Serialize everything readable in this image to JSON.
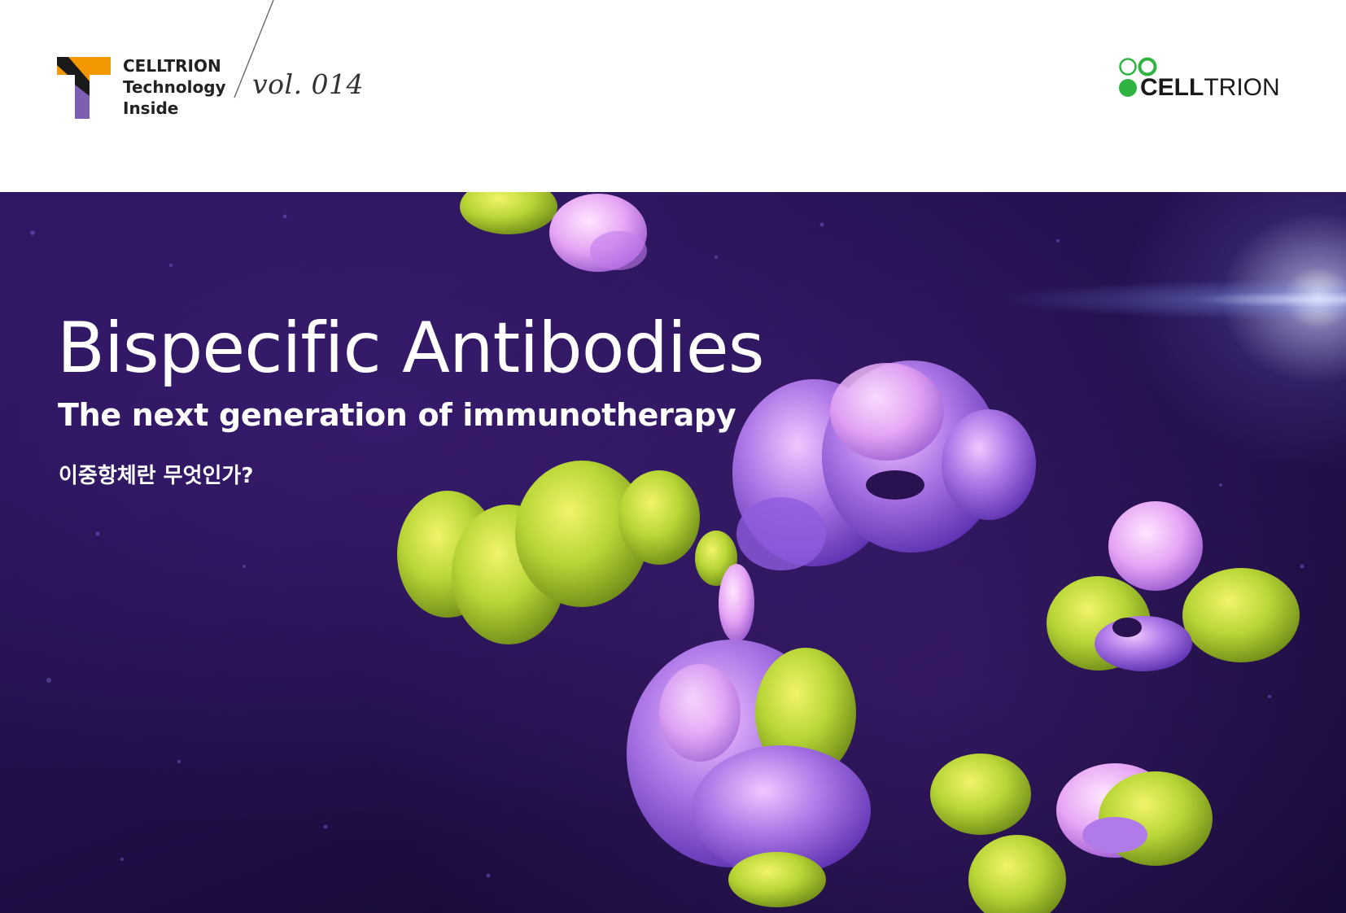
{
  "header": {
    "brand_lines": [
      "CELLTRION",
      "Technology",
      "Inside"
    ],
    "issue": "vol. 014",
    "logo": {
      "name_bold": "CELL",
      "name_light": "TRION"
    }
  },
  "hero": {
    "title": "Bispecific Antibodies",
    "subtitle": "The next generation of immunotherapy",
    "korean_question": "이중항체란 무엇인가?"
  },
  "colors": {
    "t_logo_orange": "#f39800",
    "t_logo_purple": "#7d5fb2",
    "t_logo_black": "#1a1a1a",
    "celltrion_green": "#2fb343",
    "hero_background": "#24104e",
    "protein_purple": "#b07ae8",
    "protein_yellow_green": "#c8dc3c"
  },
  "icons": [
    "celltrion-technology-inside-t-logo",
    "celltrion-circles-logo"
  ]
}
